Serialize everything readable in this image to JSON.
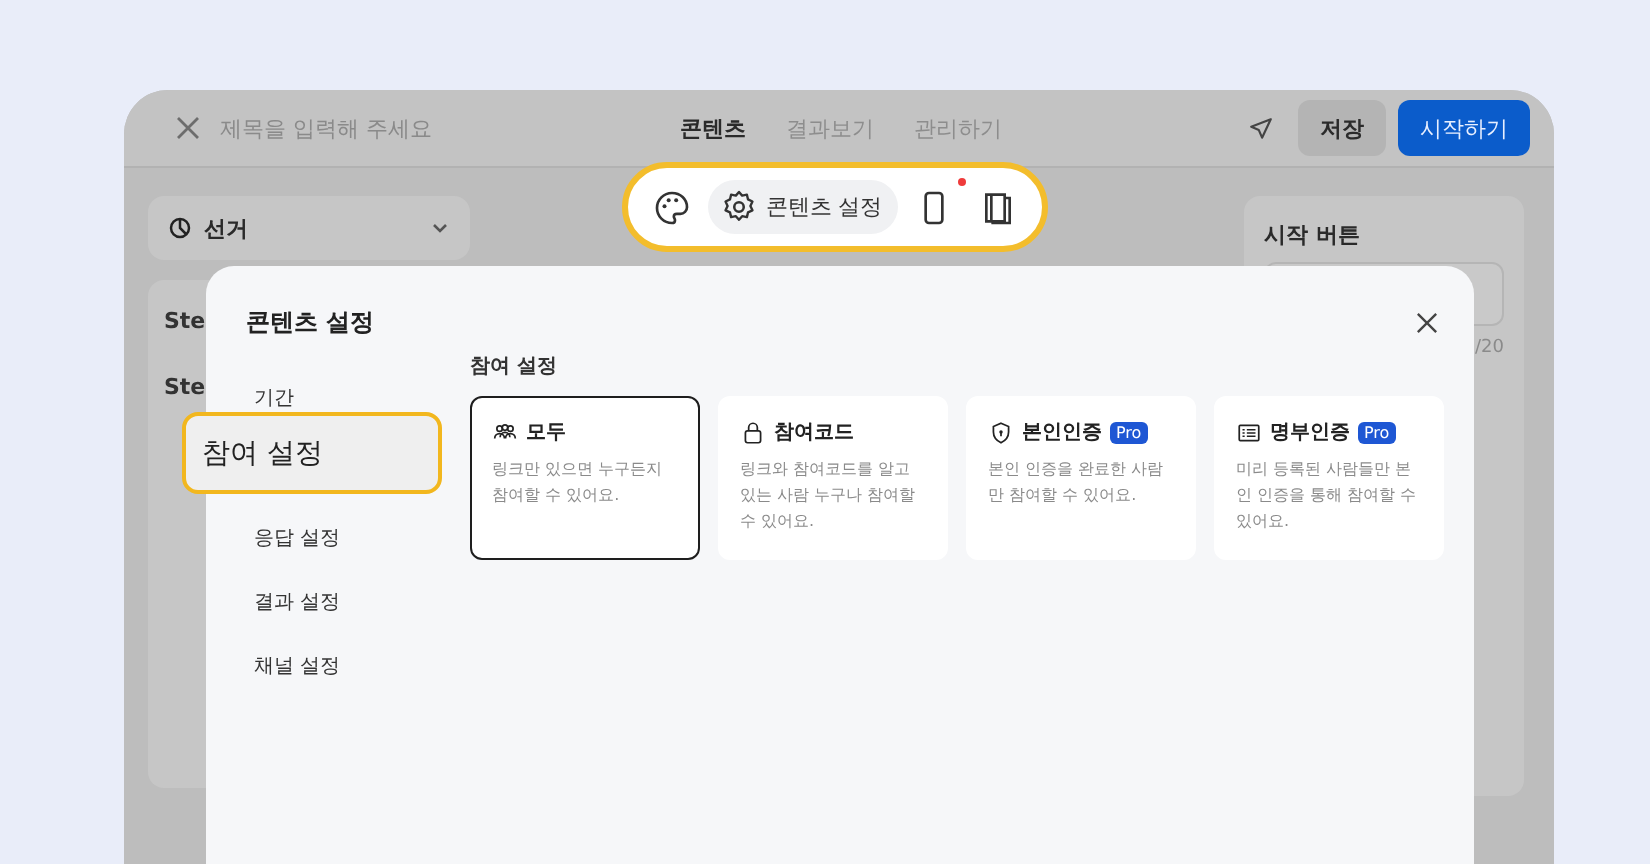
{
  "top_bar": {
    "title_placeholder": "제목을 입력해 주세요",
    "tabs": [
      {
        "label": "콘텐츠",
        "selected": true
      },
      {
        "label": "결과보기",
        "selected": false
      },
      {
        "label": "관리하기",
        "selected": false
      }
    ],
    "buttons": [
      {
        "label": "저장",
        "kind": "secondary"
      },
      {
        "label": "시작하기",
        "kind": "primary"
      }
    ]
  },
  "toolbar": {
    "items": [
      {
        "kind": "palette",
        "selected": false,
        "badge": false
      },
      {
        "kind": "gear",
        "label": "콘텐츠 설정",
        "selected": true,
        "badge": false
      },
      {
        "kind": "phone",
        "selected": false,
        "badge": true
      },
      {
        "kind": "book",
        "selected": false,
        "badge": false
      }
    ]
  },
  "editor": {
    "dropdown": {
      "label": "선거"
    },
    "steps": [
      "Ste",
      "Ste"
    ],
    "right_panel": {
      "title": "시작 버튼",
      "counter": "/20"
    }
  },
  "modal": {
    "title": "콘텐츠 설정",
    "sidebar": [
      {
        "label": "기간",
        "selected": false
      },
      {
        "label": "참여 설정",
        "selected": true
      },
      {
        "label": "응답 설정",
        "selected": false
      },
      {
        "label": "결과 설정",
        "selected": false
      },
      {
        "label": "채널 설정",
        "selected": false
      }
    ],
    "section_title": "참여 설정",
    "options": [
      {
        "kind": "people",
        "title": "모두",
        "description": "링크만 있으면 누구든지 참여할 수 있어요.",
        "selected": true
      },
      {
        "kind": "lock",
        "title": "참여코드",
        "description": "링크와 참여코드를 알고 있는 사람 누구나 참여할 수 있어요.",
        "selected": false
      },
      {
        "kind": "shield",
        "title": "본인인증",
        "badge": "Pro",
        "description": "본인 인증을 완료한 사람만 참여할 수 있어요.",
        "selected": false
      },
      {
        "kind": "list",
        "title": "명부인증",
        "badge": "Pro",
        "description": "미리 등록된 사람들만 본인 인증을 통해 참여할 수 있어요.",
        "selected": false
      }
    ]
  }
}
